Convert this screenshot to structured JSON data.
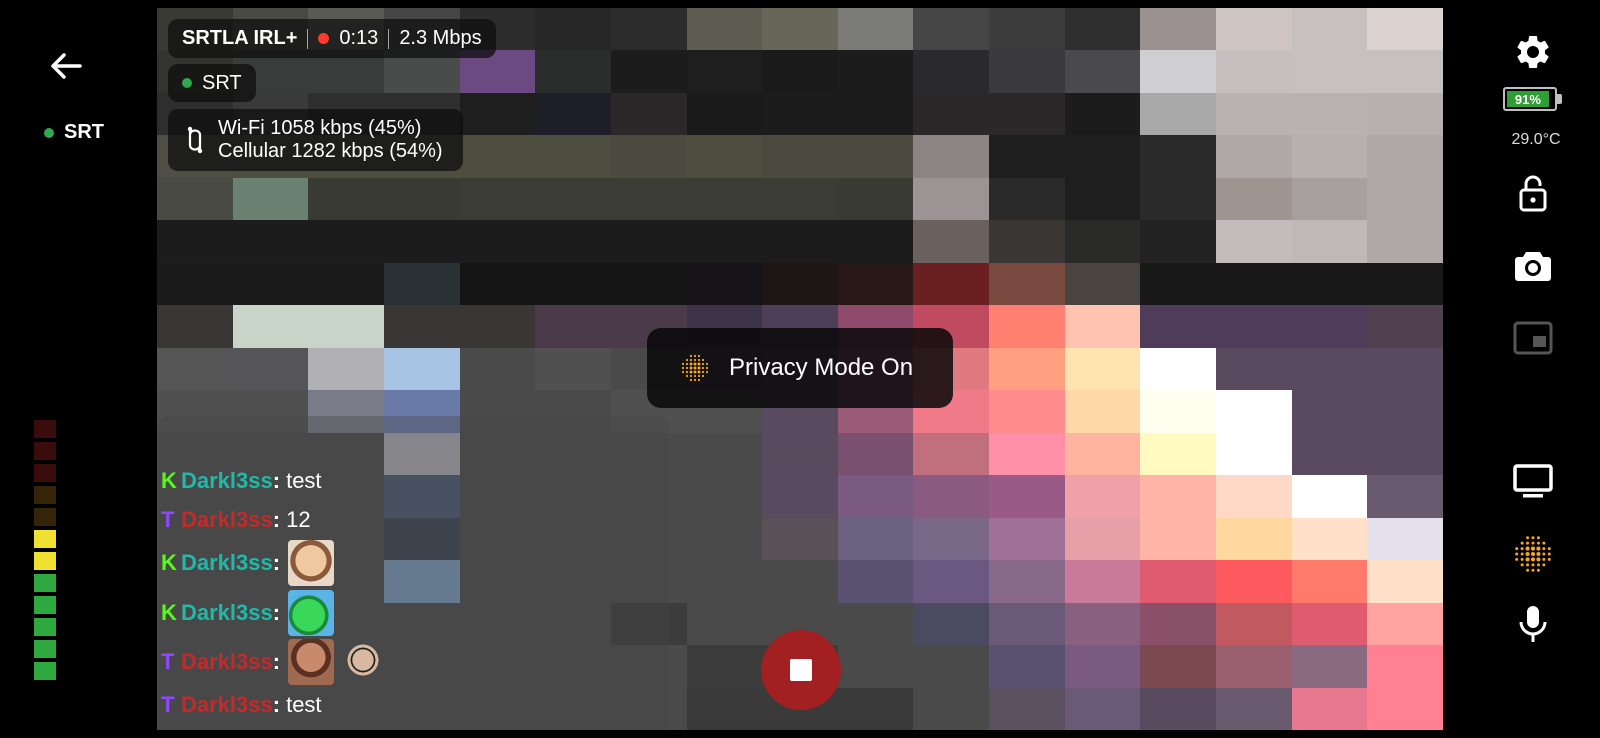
{
  "header": {
    "stream_name": "SRTLA IRL+",
    "record_time": "0:13",
    "bitrate": "2.3 Mbps"
  },
  "protocol": {
    "label": "SRT"
  },
  "left_status": {
    "label": "SRT"
  },
  "bonding": {
    "wifi": "Wi-Fi 1058 kbps (45%)",
    "cellular": "Cellular 1282 kbps (54%)"
  },
  "toast": {
    "text": "Privacy Mode On"
  },
  "chat": [
    {
      "platform": "K",
      "platform_color": "#53fc18",
      "user": "Darkl3ss",
      "user_color": "#22b8a8",
      "sep": ":",
      "message": "test",
      "emotes": []
    },
    {
      "platform": "T",
      "platform_color": "#9146ff",
      "user": "Darkl3ss",
      "user_color": "#c52a2a",
      "sep": ":",
      "message": "12",
      "emotes": []
    },
    {
      "platform": "K",
      "platform_color": "#53fc18",
      "user": "Darkl3ss",
      "user_color": "#22b8a8",
      "sep": ":",
      "message": "",
      "emotes": [
        "laughing-face-emote"
      ]
    },
    {
      "platform": "K",
      "platform_color": "#53fc18",
      "user": "Darkl3ss",
      "user_color": "#22b8a8",
      "sep": ":",
      "message": "",
      "emotes": [
        "green-creature-emote"
      ]
    },
    {
      "platform": "T",
      "platform_color": "#9146ff",
      "user": "Darkl3ss",
      "user_color": "#c52a2a",
      "sep": ":",
      "message": "",
      "emotes": [
        "laughing-man-emote",
        "sunglasses-man-emote"
      ]
    },
    {
      "platform": "T",
      "platform_color": "#9146ff",
      "user": "Darkl3ss",
      "user_color": "#c52a2a",
      "sep": ":",
      "message": "test",
      "emotes": []
    }
  ],
  "status": {
    "battery_percent": "91%",
    "temperature": "29.0°C"
  },
  "colors": {
    "live_dot": "#ff3b30",
    "connected_dot": "#2fa84f",
    "record_button": "#a21f22",
    "privacy_icon": "#f5a623"
  },
  "icons": {
    "back": "back-arrow-icon",
    "settings": "gear-icon",
    "lock": "lock-open-icon",
    "camera": "camera-icon",
    "pip": "picture-in-picture-icon",
    "display": "monitor-icon",
    "privacy": "privacy-mode-icon",
    "mic": "microphone-icon",
    "bonding": "bonding-icon",
    "stop": "stop-icon"
  },
  "audio_meter": {
    "level": 0.55
  }
}
